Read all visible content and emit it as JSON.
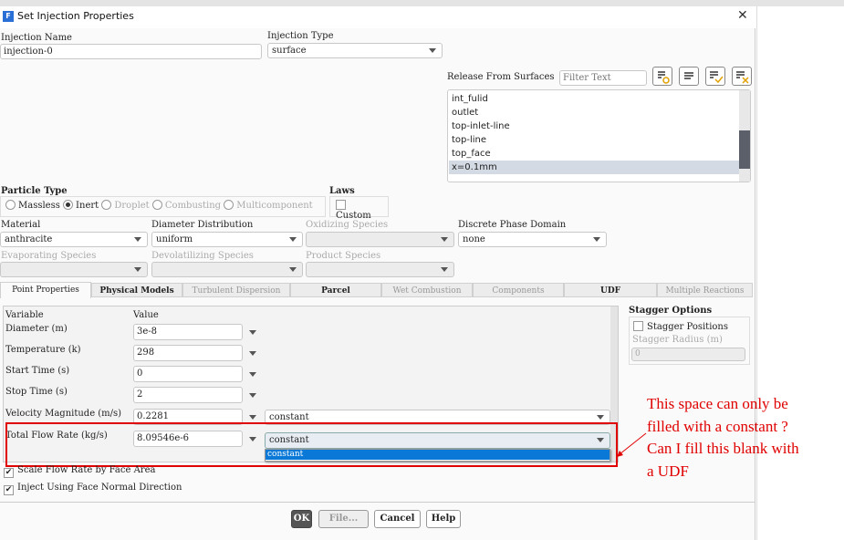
{
  "window": {
    "title": "Set Injection Properties",
    "close": "✕",
    "app_icon": "F"
  },
  "injection_name": {
    "label": "Injection Name",
    "value": "injection-0"
  },
  "injection_type": {
    "label": "Injection Type",
    "value": "surface"
  },
  "release": {
    "label": "Release From Surfaces",
    "filter_placeholder": "Filter Text",
    "surfaces": [
      "int_fulid",
      "outlet",
      "top-inlet-line",
      "top-line",
      "top_face",
      "x=0.1mm"
    ],
    "selected": "x=0.1mm"
  },
  "particle_type": {
    "label": "Particle Type",
    "options": [
      "Massless",
      "Inert",
      "Droplet",
      "Combusting",
      "Multicomponent"
    ],
    "selected": "Inert"
  },
  "laws": {
    "label": "Laws",
    "custom": "Custom"
  },
  "material": {
    "label": "Material",
    "value": "anthracite"
  },
  "diameter_distribution": {
    "label": "Diameter Distribution",
    "value": "uniform"
  },
  "oxidizing_species": {
    "label": "Oxidizing Species"
  },
  "discrete_phase_domain": {
    "label": "Discrete Phase Domain",
    "value": "none"
  },
  "evaporating_species": {
    "label": "Evaporating Species"
  },
  "devolatilizing_species": {
    "label": "Devolatilizing Species"
  },
  "product_species": {
    "label": "Product Species"
  },
  "tabs": [
    "Point Properties",
    "Physical Models",
    "Turbulent Dispersion",
    "Parcel",
    "Wet Combustion",
    "Components",
    "UDF",
    "Multiple Reactions"
  ],
  "point_properties": {
    "col_variable": "Variable",
    "col_value": "Value",
    "rows": [
      {
        "label": "Diameter (m)",
        "value": "3e-8"
      },
      {
        "label": "Temperature (k)",
        "value": "298"
      },
      {
        "label": "Start Time (s)",
        "value": "0"
      },
      {
        "label": "Stop Time (s)",
        "value": "2"
      },
      {
        "label": "Velocity Magnitude (m/s)",
        "value": "0.2281",
        "profile": "constant"
      },
      {
        "label": "Total Flow Rate (kg/s)",
        "value": "8.09546e-6",
        "profile": "constant"
      }
    ],
    "dropdown_option": "constant"
  },
  "scale_flow": {
    "label": "Scale Flow Rate by Face Area",
    "checked": true
  },
  "face_normal": {
    "label": "Inject Using Face Normal Direction",
    "checked": true
  },
  "stagger": {
    "title": "Stagger Options",
    "positions": "Stagger Positions",
    "radius_label": "Stagger Radius (m)",
    "radius_value": "0"
  },
  "buttons": {
    "ok": "OK",
    "file": "File...",
    "cancel": "Cancel",
    "help": "Help"
  },
  "annotation": "This space can only be filled with a constant ? Can I fill this blank with  a UDF",
  "colors": {
    "annotation": "#e00000",
    "selection": "#0a78d7"
  }
}
